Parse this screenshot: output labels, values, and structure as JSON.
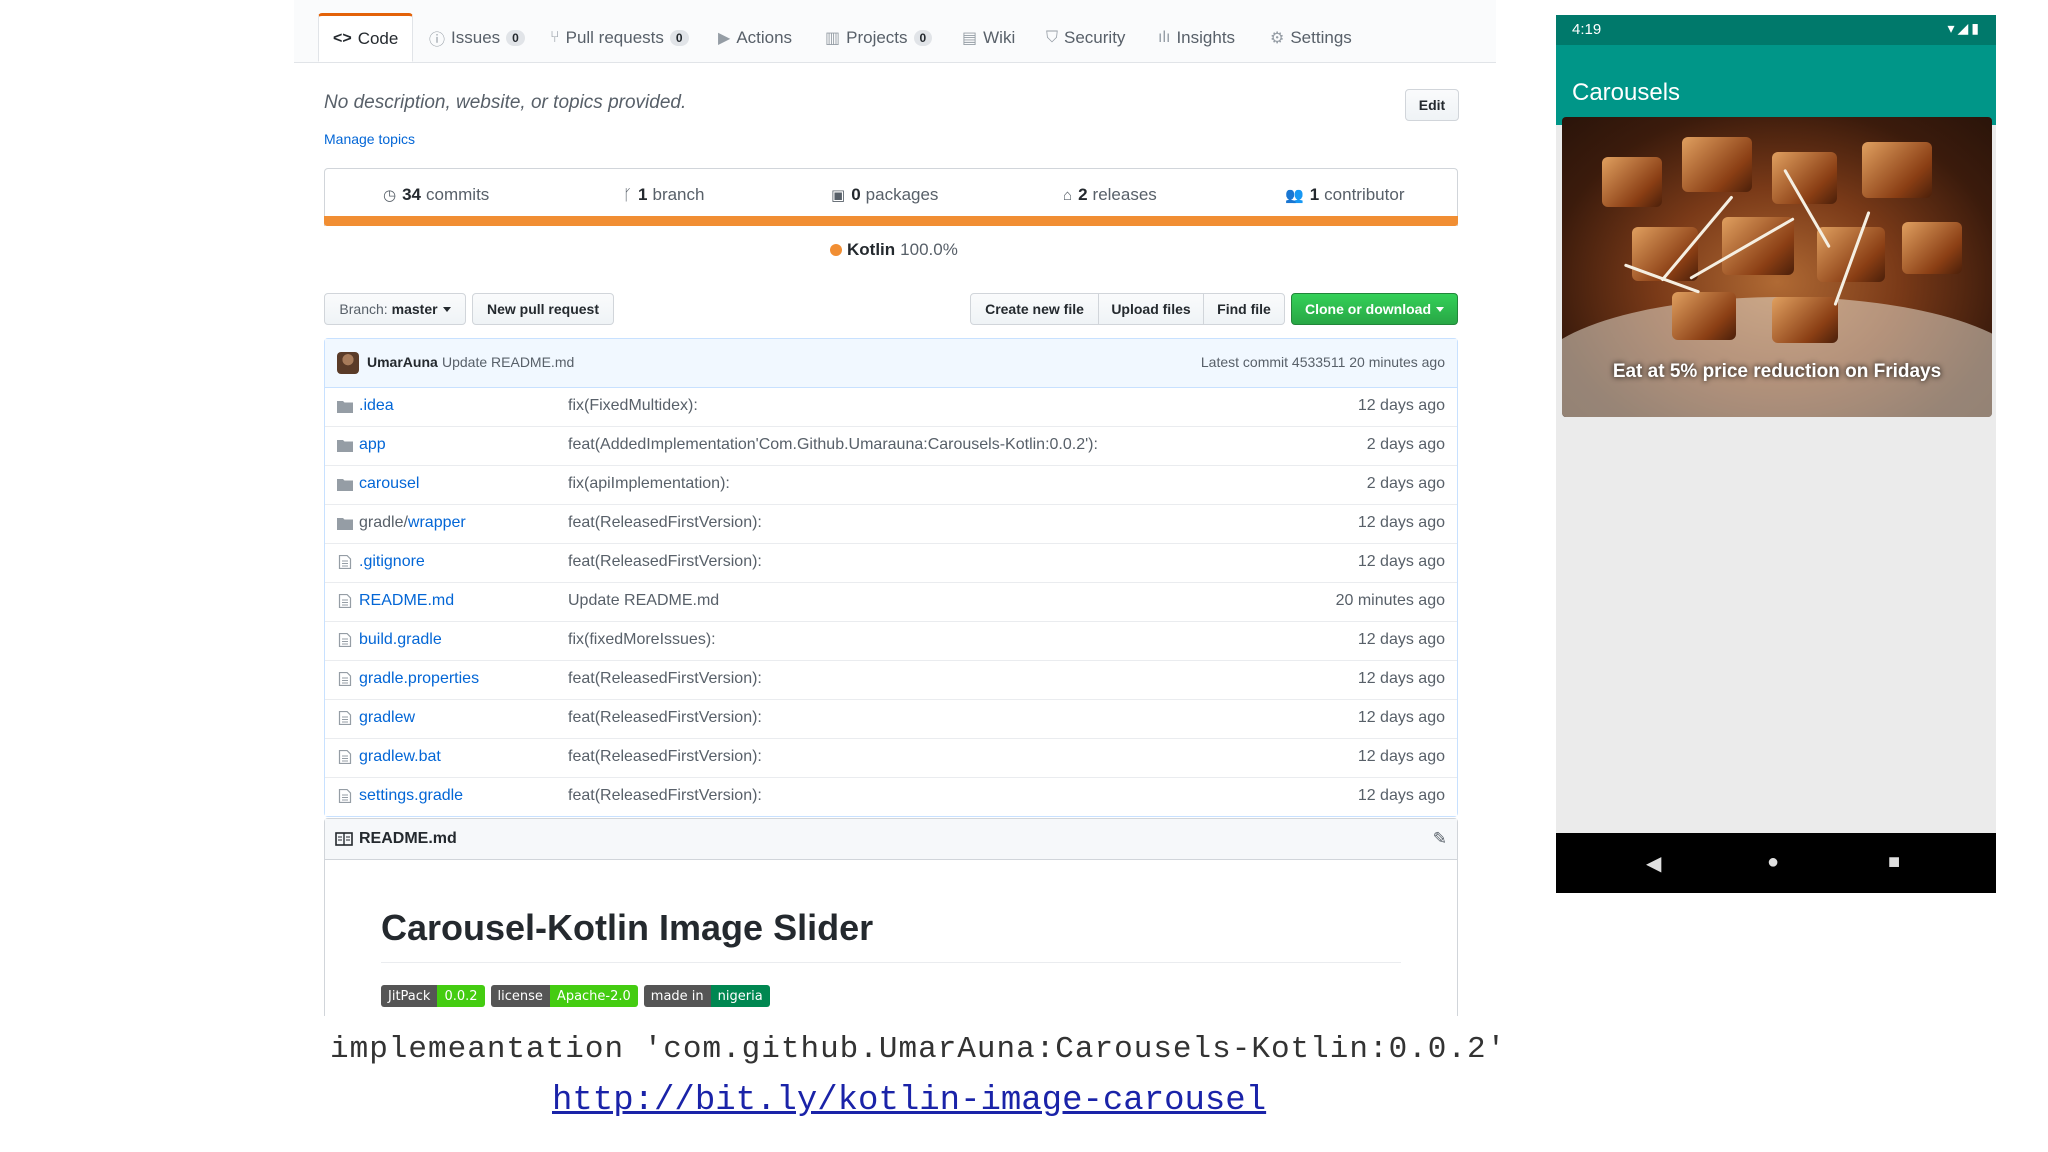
{
  "github": {
    "tabs": [
      {
        "label": "Code",
        "icon": "code-icon",
        "count": null
      },
      {
        "label": "Issues",
        "icon": "issue-icon",
        "count": "0"
      },
      {
        "label": "Pull requests",
        "icon": "pull-request-icon",
        "count": "0"
      },
      {
        "label": "Actions",
        "icon": "play-icon",
        "count": null
      },
      {
        "label": "Projects",
        "icon": "project-icon",
        "count": "0"
      },
      {
        "label": "Wiki",
        "icon": "book-icon",
        "count": null
      },
      {
        "label": "Security",
        "icon": "shield-icon",
        "count": null
      },
      {
        "label": "Insights",
        "icon": "graph-icon",
        "count": null
      },
      {
        "label": "Settings",
        "icon": "gear-icon",
        "count": null
      }
    ],
    "description": "No description, website, or topics provided.",
    "manage_topics": "Manage topics",
    "edit_label": "Edit",
    "summary": {
      "commits_num": "34",
      "commits_label": "commits",
      "branch_num": "1",
      "branch_label": "branch",
      "packages_num": "0",
      "packages_label": "packages",
      "releases_num": "2",
      "releases_label": "releases",
      "contributor_num": "1",
      "contributor_label": "contributor"
    },
    "language": {
      "name": "Kotlin",
      "percent": "100.0%",
      "color": "#f18e33"
    },
    "branch_prefix": "Branch:",
    "branch_name": "master",
    "new_pull_request": "New pull request",
    "create_new_file": "Create new file",
    "upload_files": "Upload files",
    "find_file": "Find file",
    "clone_download": "Clone or download",
    "latest_commit": {
      "author": "UmarAuna",
      "message": "Update README.md",
      "info": "Latest commit 4533511 20 minutes ago"
    },
    "files": [
      {
        "prefix": "",
        "name": ".idea",
        "type": "folder",
        "message": "fix(FixedMultidex):",
        "age": "12 days ago"
      },
      {
        "prefix": "",
        "name": "app",
        "type": "folder",
        "message": "feat(AddedImplementation'Com.Github.Umarauna:Carousels-Kotlin:0.0.2'):",
        "age": "2 days ago"
      },
      {
        "prefix": "",
        "name": "carousel",
        "type": "folder",
        "message": "fix(apiImplementation):",
        "age": "2 days ago"
      },
      {
        "prefix": "gradle/",
        "name": "wrapper",
        "type": "folder",
        "message": "feat(ReleasedFirstVersion):",
        "age": "12 days ago"
      },
      {
        "prefix": "",
        "name": ".gitignore",
        "type": "file",
        "message": "feat(ReleasedFirstVersion):",
        "age": "12 days ago"
      },
      {
        "prefix": "",
        "name": "README.md",
        "type": "file",
        "message": "Update README.md",
        "age": "20 minutes ago"
      },
      {
        "prefix": "",
        "name": "build.gradle",
        "type": "file",
        "message": "fix(fixedMoreIssues):",
        "age": "12 days ago"
      },
      {
        "prefix": "",
        "name": "gradle.properties",
        "type": "file",
        "message": "feat(ReleasedFirstVersion):",
        "age": "12 days ago"
      },
      {
        "prefix": "",
        "name": "gradlew",
        "type": "file",
        "message": "feat(ReleasedFirstVersion):",
        "age": "12 days ago"
      },
      {
        "prefix": "",
        "name": "gradlew.bat",
        "type": "file",
        "message": "feat(ReleasedFirstVersion):",
        "age": "12 days ago"
      },
      {
        "prefix": "",
        "name": "settings.gradle",
        "type": "file",
        "message": "feat(ReleasedFirstVersion):",
        "age": "12 days ago"
      }
    ],
    "readme": {
      "file_label": "README.md",
      "heading": "Carousel-Kotlin Image Slider",
      "badges": [
        {
          "left": "JitPack",
          "right": "0.0.2"
        },
        {
          "left": "license",
          "right": "Apache-2.0"
        },
        {
          "left": "made in",
          "right": "nigeria"
        }
      ]
    }
  },
  "footer": {
    "implementation": "implemeantation 'com.github.UmarAuna:Carousels-Kotlin:0.0.2'",
    "link": "http://bit.ly/kotlin-image-carousel"
  },
  "phone": {
    "time": "4:19",
    "app_title": "Carousels",
    "caption": "Eat at 5% price reduction on Fridays",
    "accent": "#009688"
  }
}
